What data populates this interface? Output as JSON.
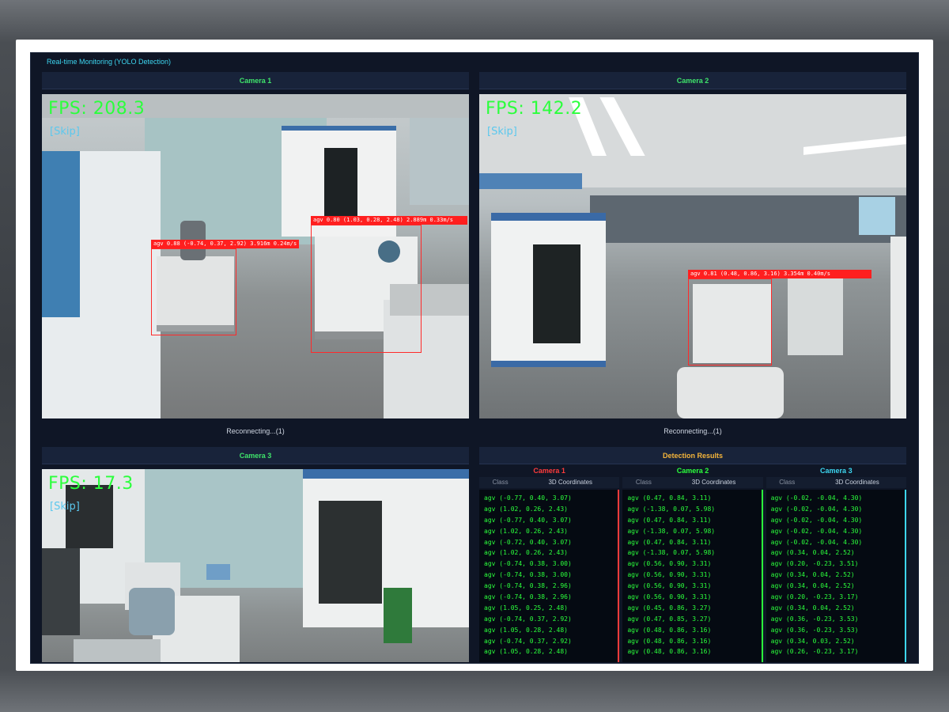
{
  "app": {
    "title": "Real-time Monitoring (YOLO Detection)"
  },
  "cameras": [
    {
      "name": "Camera 1",
      "fps": "FPS: 208.3",
      "skip": "[Skip]",
      "status": "Reconnecting...(1)",
      "detections": [
        {
          "label": "agv 0.88 (-0.74, 0.37, 2.92) 3.916m 0.24m/s"
        },
        {
          "label": "agv 0.80 (1.03, 0.28, 2.48) 2.889m 0.33m/s"
        }
      ]
    },
    {
      "name": "Camera 2",
      "fps": "FPS: 142.2",
      "skip": "[Skip]",
      "status": "Reconnecting...(1)",
      "detections": [
        {
          "label": "agv 0.81 (0.48, 0.86, 3.16) 3.354m 0.40m/s"
        }
      ]
    },
    {
      "name": "Camera 3",
      "fps": "FPS: 17.3",
      "skip": "[Skip]",
      "status": "",
      "detections": []
    }
  ],
  "results": {
    "title": "Detection Results",
    "header_class": "Class",
    "header_coords": "3D Coordinates",
    "columns": [
      {
        "name": "Camera 1",
        "color": "#ff3b3b",
        "rows": [
          "agv (-0.77, 0.40, 3.07)",
          "agv (1.02, 0.26, 2.43)",
          "agv (-0.77, 0.40, 3.07)",
          "agv (1.02, 0.26, 2.43)",
          "agv (-0.72, 0.40, 3.07)",
          "agv (1.02, 0.26, 2.43)",
          "agv (-0.74, 0.38, 3.00)",
          "agv (-0.74, 0.38, 3.00)",
          "agv (-0.74, 0.38, 2.96)",
          "agv (-0.74, 0.38, 2.96)",
          "agv (1.05, 0.25, 2.48)",
          "agv (-0.74, 0.37, 2.92)",
          "agv (1.05, 0.28, 2.48)",
          "agv (-0.74, 0.37, 2.92)",
          "agv (1.05, 0.28, 2.48)"
        ]
      },
      {
        "name": "Camera 2",
        "color": "#2bff3c",
        "rows": [
          "agv (0.47, 0.84, 3.11)",
          "agv (-1.38, 0.07, 5.98)",
          "agv (0.47, 0.84, 3.11)",
          "agv (-1.38, 0.07, 5.98)",
          "agv (0.47, 0.84, 3.11)",
          "agv (-1.38, 0.07, 5.98)",
          "agv (0.56, 0.90, 3.31)",
          "agv (0.56, 0.90, 3.31)",
          "agv (0.56, 0.90, 3.31)",
          "agv (0.56, 0.90, 3.31)",
          "agv (0.45, 0.86, 3.27)",
          "agv (0.47, 0.85, 3.27)",
          "agv (0.48, 0.86, 3.16)",
          "agv (0.48, 0.86, 3.16)",
          "agv (0.48, 0.86, 3.16)"
        ]
      },
      {
        "name": "Camera 3",
        "color": "#3dd6f0",
        "rows": [
          "agv (-0.02, -0.04, 4.30)",
          "agv (-0.02, -0.04, 4.30)",
          "agv (-0.02, -0.04, 4.30)",
          "agv (-0.02, -0.04, 4.30)",
          "agv (-0.02, -0.04, 4.30)",
          "agv (0.34, 0.04, 2.52)",
          "agv (0.20, -0.23, 3.51)",
          "agv (0.34, 0.04, 2.52)",
          "agv (0.34, 0.04, 2.52)",
          "agv (0.20, -0.23, 3.17)",
          "agv (0.34, 0.04, 2.52)",
          "agv (0.36, -0.23, 3.53)",
          "agv (0.36, -0.23, 3.53)",
          "agv (0.34, 0.03, 2.52)",
          "agv (0.26, -0.23, 3.17)"
        ]
      }
    ]
  }
}
